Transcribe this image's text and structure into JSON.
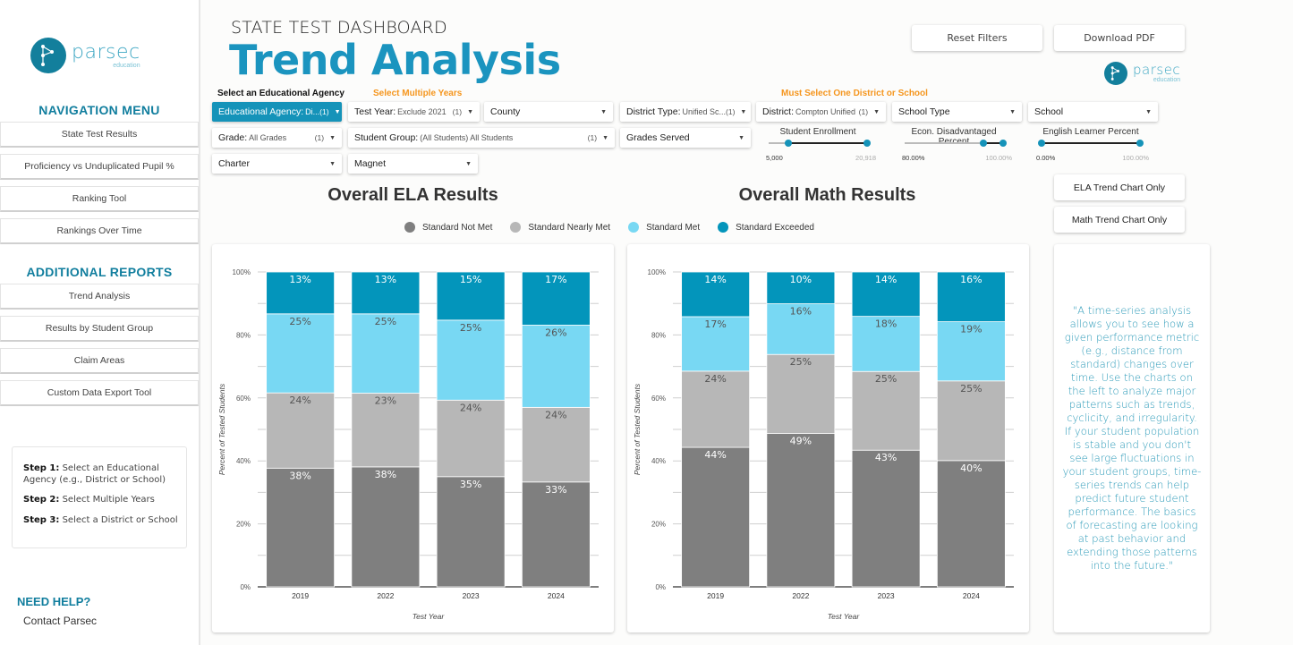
{
  "brand": {
    "name": "parsec",
    "tagline": "education",
    "color": "#137f9c"
  },
  "sidebar": {
    "nav_heading": "NAVIGATION MENU",
    "nav_items": [
      {
        "label": "State Test Results"
      },
      {
        "label": "Proficiency vs Unduplicated Pupil %"
      },
      {
        "label": "Ranking Tool"
      },
      {
        "label": "Rankings Over Time"
      }
    ],
    "reports_heading": "ADDITIONAL REPORTS",
    "report_items": [
      {
        "label": "Trend Analysis"
      },
      {
        "label": "Results by Student Group"
      },
      {
        "label": "Claim Areas"
      },
      {
        "label": "Custom Data Export Tool"
      }
    ],
    "steps": [
      {
        "label": "Step 1:",
        "text": "Select an Educational Agency (e.g., District or School)"
      },
      {
        "label": "Step 2:",
        "text": "Select Multiple Years"
      },
      {
        "label": "Step 3:",
        "text": "Select a District or School"
      }
    ],
    "help_heading": "NEED HELP?",
    "help_link": "Contact Parsec"
  },
  "header": {
    "subtitle": "STATE TEST DASHBOARD",
    "title": "Trend Analysis",
    "reset_button": "Reset Filters",
    "download_button": "Download PDF"
  },
  "filter_labels": {
    "agency": "Select an Educational Agency",
    "years": "Select Multiple Years",
    "district": "Must Select One District or School"
  },
  "filters": {
    "educational_agency": {
      "label": "Educational Agency",
      "value": "Di...",
      "count": "(1)"
    },
    "test_year": {
      "label": "Test Year",
      "value": "Exclude 2021",
      "count": "(1)"
    },
    "county": {
      "label": "County"
    },
    "district_type": {
      "label": "District Type",
      "value": "Unified Sc...",
      "count": "(1)"
    },
    "district": {
      "label": "District",
      "value": "Compton Unified",
      "count": "(1)"
    },
    "school_type": {
      "label": "School Type"
    },
    "school": {
      "label": "School"
    },
    "grade": {
      "label": "Grade",
      "value": "All Grades",
      "count": "(1)"
    },
    "student_group": {
      "label": "Student Group",
      "value": "(All Students) All Students",
      "count": "(1)"
    },
    "grades_served": {
      "label": "Grades Served"
    },
    "charter": {
      "label": "Charter"
    },
    "magnet": {
      "label": "Magnet"
    }
  },
  "sliders": [
    {
      "title": "Student Enrollment",
      "min_label": "5,000",
      "max_label": "20,918",
      "low_fraction": 0.2,
      "high_fraction": 1.0
    },
    {
      "title": "Econ. Disadvantaged Percent",
      "min_label": "80.00%",
      "max_label": "100.00%",
      "low_fraction": 0.8,
      "high_fraction": 1.0
    },
    {
      "title": "English Learner Percent",
      "min_label": "0.00%",
      "max_label": "100.00%",
      "low_fraction": 0.0,
      "high_fraction": 1.0
    }
  ],
  "side_buttons": {
    "ela_only": "ELA Trend Chart Only",
    "math_only": "Math Trend Chart Only"
  },
  "legend": [
    {
      "label": "Standard Not Met",
      "color": "#7f7f7f"
    },
    {
      "label": "Standard Nearly Met",
      "color": "#b7b7b7"
    },
    {
      "label": "Standard Met",
      "color": "#78d8f3"
    },
    {
      "label": "Standard Exceeded",
      "color": "#0395bb"
    }
  ],
  "quote": "\"A time-series analysis allows you to see how a given performance metric (e.g., distance from standard) changes over time. Use the charts on the left to analyze major patterns such as trends, cyclicity, and irregularity. If your student population is stable and you don't see large fluctuations in your student groups, time-series trends can help predict future student performance. The basics of forecasting are looking at past behavior and extending those patterns into the future.\"",
  "chart_data": [
    {
      "type": "bar",
      "stacked": true,
      "title": "Overall ELA Results",
      "xlabel": "Test Year",
      "ylabel": "Percent of Tested Students",
      "categories": [
        "2019",
        "2022",
        "2023",
        "2024"
      ],
      "ylim": [
        0,
        100
      ],
      "yticks": [
        "0%",
        "20%",
        "40%",
        "60%",
        "80%",
        "100%"
      ],
      "grid": true,
      "legend_position": "top",
      "series": [
        {
          "name": "Standard Not Met",
          "color": "#7f7f7f",
          "label_color": "#ffffff",
          "values": [
            38,
            38,
            35,
            33
          ],
          "display_values": [
            37.7,
            38.1,
            35.0,
            33.3
          ]
        },
        {
          "name": "Standard Nearly Met",
          "color": "#b7b7b7",
          "label_color": "#555555",
          "values": [
            24,
            23,
            24,
            24
          ],
          "display_values": [
            23.9,
            23.4,
            24.3,
            23.7
          ]
        },
        {
          "name": "Standard Met",
          "color": "#78d8f3",
          "label_color": "#555555",
          "values": [
            25,
            25,
            25,
            26
          ],
          "display_values": [
            25.1,
            25.2,
            25.4,
            26.1
          ]
        },
        {
          "name": "Standard Exceeded",
          "color": "#0395bb",
          "label_color": "#ffffff",
          "values": [
            13,
            13,
            15,
            17
          ],
          "display_values": [
            13.3,
            13.3,
            15.3,
            16.9
          ]
        }
      ]
    },
    {
      "type": "bar",
      "stacked": true,
      "title": "Overall Math Results",
      "xlabel": "Test Year",
      "ylabel": "Percent of Tested Students",
      "categories": [
        "2019",
        "2022",
        "2023",
        "2024"
      ],
      "ylim": [
        0,
        100
      ],
      "yticks": [
        "0%",
        "20%",
        "40%",
        "60%",
        "80%",
        "100%"
      ],
      "grid": true,
      "legend_position": "top",
      "series": [
        {
          "name": "Standard Not Met",
          "color": "#7f7f7f",
          "label_color": "#ffffff",
          "values": [
            44,
            49,
            43,
            40
          ],
          "display_values": [
            44.3,
            48.7,
            43.4,
            40.1
          ]
        },
        {
          "name": "Standard Nearly Met",
          "color": "#b7b7b7",
          "label_color": "#555555",
          "values": [
            24,
            25,
            25,
            25
          ],
          "display_values": [
            24.2,
            25.1,
            25.0,
            25.3
          ]
        },
        {
          "name": "Standard Met",
          "color": "#78d8f3",
          "label_color": "#555555",
          "values": [
            17,
            16,
            18,
            19
          ],
          "display_values": [
            17.3,
            16.1,
            17.5,
            18.8
          ]
        },
        {
          "name": "Standard Exceeded",
          "color": "#0395bb",
          "label_color": "#ffffff",
          "values": [
            14,
            10,
            14,
            16
          ],
          "display_values": [
            14.2,
            10.1,
            14.1,
            15.8
          ]
        }
      ]
    }
  ]
}
